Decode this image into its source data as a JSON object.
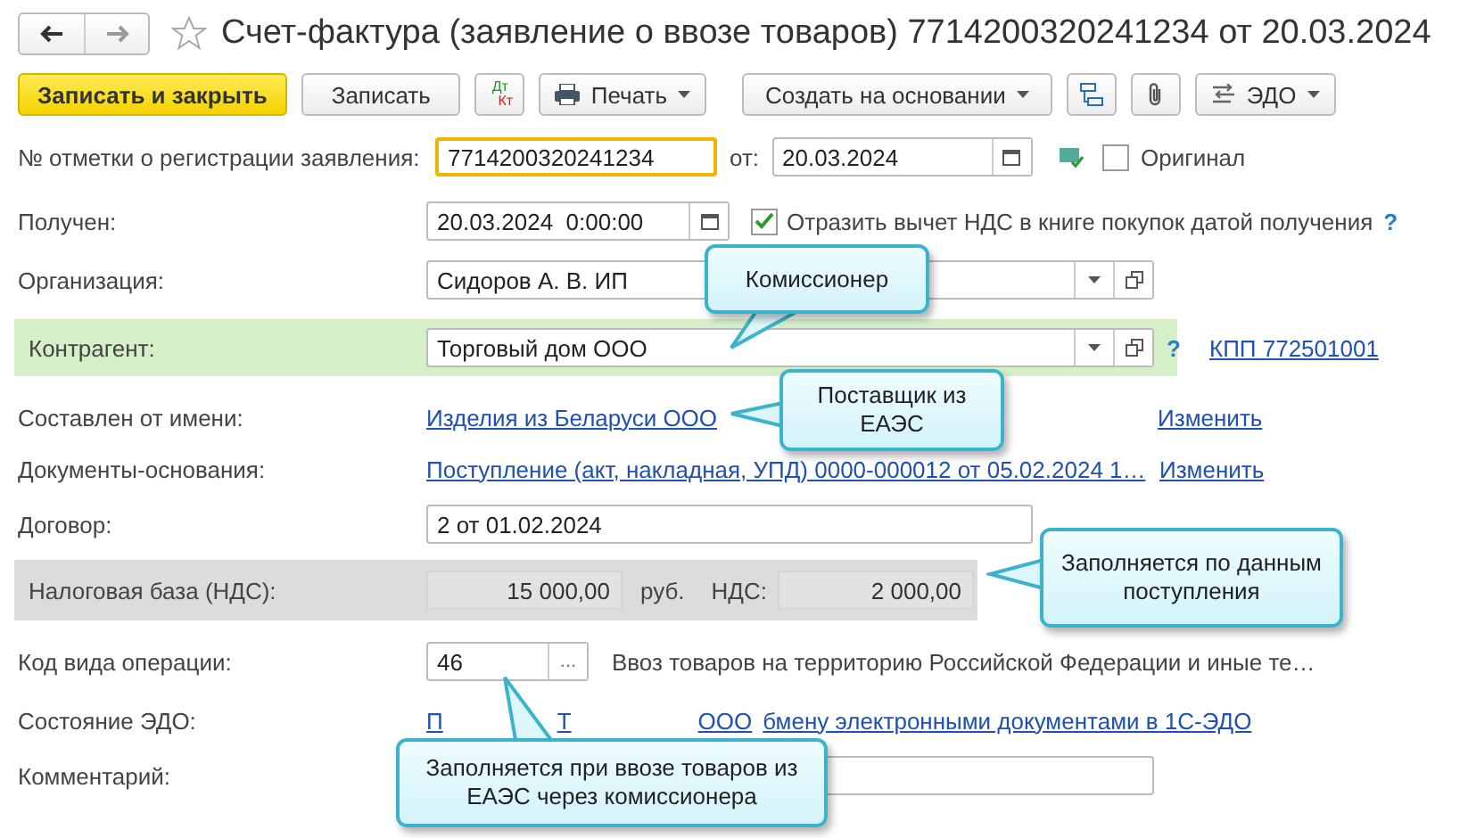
{
  "title": "Счет-фактура (заявление о ввозе товаров) 7714200320241234 от 20.03.2024",
  "favorite": false,
  "toolbar": [
    {
      "kind": "primary",
      "label": "Записать и закрыть"
    },
    {
      "kind": "plain",
      "label": "Записать"
    },
    {
      "kind": "dtkt",
      "top": "Дт",
      "bottom": "Кт"
    },
    {
      "kind": "print-menu",
      "label": "Печать"
    },
    {
      "kind": "menu",
      "label": "Создать на основании"
    },
    {
      "kind": "structure"
    },
    {
      "kind": "attach"
    },
    {
      "kind": "edo-menu",
      "label": "ЭДО"
    }
  ],
  "registration": {
    "label": "№ отметки о регистрации заявления:",
    "value": "7714200320241234",
    "focused": true,
    "date_label": "от:",
    "date": "20.03.2024",
    "original": {
      "label": "Оригинал",
      "checked": false
    }
  },
  "received": {
    "label": "Получен:",
    "value": "20.03.2024  0:00:00",
    "option": {
      "label": "Отразить вычет НДС в книге покупок датой получения",
      "checked": true
    },
    "help": "?"
  },
  "organization": {
    "label": "Организация:",
    "value": "Сидоров А. В. ИП"
  },
  "counterparty": {
    "label": "Контрагент:",
    "value": "Торговый дом ООО",
    "highlighted": true,
    "help": "?",
    "kpp": "КПП 772501001"
  },
  "composed_by": {
    "label": "Составлен от имени:",
    "link": "Изделия из Беларуси ООО",
    "action": "Изменить"
  },
  "base_documents": {
    "label": "Документы-основания:",
    "link": "Поступление (акт, накладная, УПД) 0000-000012 от 05.02.2024 1…",
    "action": "Изменить"
  },
  "contract": {
    "label": "Договор:",
    "value": "2 от 01.02.2024"
  },
  "tax": {
    "label": "Налоговая база (НДС):",
    "base": "15 000,00",
    "currency": "руб.",
    "vat_label": "НДС:",
    "vat": "2 000,00"
  },
  "operation_code": {
    "label": "Код вида операции:",
    "value": "46",
    "button": "...",
    "description": "Ввоз товаров на территорию Российской Федерации и иные те…"
  },
  "edo_status": {
    "label": "Состояние ЭДО:",
    "link_parts": [
      "П",
      "Т",
      "ООО",
      "бмену электронными документами в 1С-ЭДО"
    ]
  },
  "comment": {
    "label": "Комментарий:"
  },
  "callouts": [
    {
      "text": "Комиссионер"
    },
    {
      "text": "Поставщик из ЕАЭС"
    },
    {
      "text": "Заполняется по данным поступления"
    },
    {
      "text": "Заполняется при ввозе товаров из ЕАЭС через комиссионера"
    }
  ]
}
